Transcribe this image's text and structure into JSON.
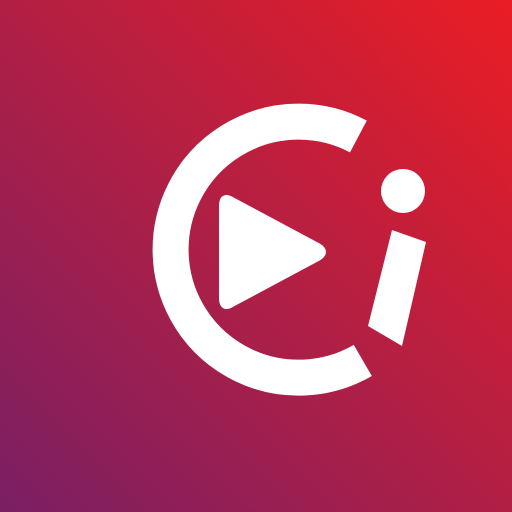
{
  "icon": {
    "name": "video-play-info-app-icon",
    "glyphs": [
      "c-arc-icon",
      "play-icon",
      "info-i-icon"
    ]
  },
  "colors": {
    "gradient_start": "#ea1d24",
    "gradient_mid": "#b11f44",
    "gradient_end": "#7a1f63",
    "glyph": "#ffffff"
  }
}
